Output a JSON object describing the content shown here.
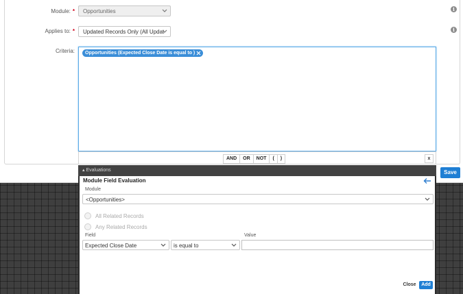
{
  "form": {
    "module_label": "Module:",
    "module_value": "Opportunities",
    "applies_label": "Applies to:",
    "applies_value": "Updated Records Only (All Updat",
    "criteria_label": "Criteria:",
    "required_mark": "*",
    "criteria_pill": "Opportunities (Expected Close Date is equal to )"
  },
  "logic_buttons": [
    "AND",
    "OR",
    "NOT",
    "(",
    ")"
  ],
  "logic_close": "x",
  "save_label": "Save",
  "evaluations": {
    "header": "Evaluations",
    "title": "Module Field Evaluation",
    "module_label": "Module",
    "module_value": "<Opportunities>",
    "radio_all": "All Related Records",
    "radio_any": "Any Related Records",
    "field_label": "Field",
    "field_value": "Expected Close Date",
    "operator_value": "is equal to",
    "value_label": "Value",
    "value_input": "",
    "close_label": "Close",
    "add_label": "Add"
  },
  "colors": {
    "accent": "#1f7fd4",
    "pill": "#3b8ed8",
    "required": "#d0021b",
    "eval_header": "#424242"
  }
}
